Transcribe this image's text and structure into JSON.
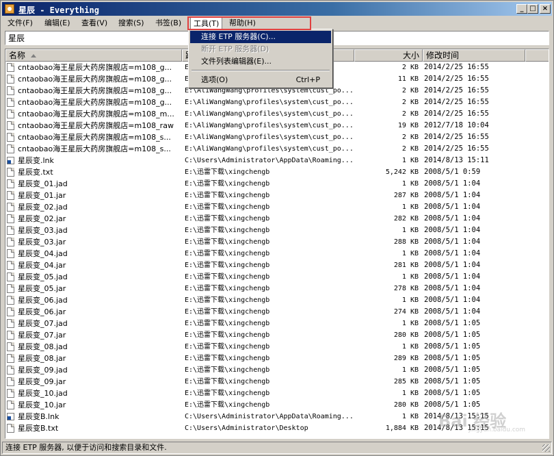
{
  "window": {
    "title": "星辰 - Everything",
    "controls": {
      "minimize": "_",
      "maximize": "□",
      "close": "×"
    }
  },
  "menubar": {
    "items": [
      {
        "label": "文件(F)"
      },
      {
        "label": "编辑(E)"
      },
      {
        "label": "查看(V)"
      },
      {
        "label": "搜索(S)"
      },
      {
        "label": "书签(B)"
      },
      {
        "label": "工具(T)"
      },
      {
        "label": "帮助(H)"
      }
    ]
  },
  "tools_menu": {
    "items": [
      {
        "label": "连接 ETP 服务器(C)...",
        "shortcut": "",
        "state": "active"
      },
      {
        "label": "断开 ETP 服务器(D)",
        "shortcut": "",
        "state": "disabled"
      },
      {
        "label": "文件列表编辑器(E)...",
        "shortcut": "",
        "state": "normal"
      },
      {
        "label": "选项(O)",
        "shortcut": "Ctrl+P",
        "state": "normal"
      }
    ]
  },
  "search": {
    "value": "星辰",
    "placeholder": ""
  },
  "columns": {
    "name": "名称",
    "path": "路",
    "size": "大小",
    "date": "修改时间"
  },
  "rows": [
    {
      "icon": "file",
      "name": "cntaobao海王星辰大药房旗舰店=m108_g...",
      "path": "E:",
      "size": "2 KB",
      "date": "2014/2/25 16:55"
    },
    {
      "icon": "file",
      "name": "cntaobao海王星辰大药房旗舰店=m108_g...",
      "path": "E:",
      "size": "11 KB",
      "date": "2014/2/25 16:55"
    },
    {
      "icon": "file",
      "name": "cntaobao海王星辰大药房旗舰店=m108_g...",
      "path": "E:\\AliWangWang\\profiles\\system\\cust_po...",
      "size": "2 KB",
      "date": "2014/2/25 16:55"
    },
    {
      "icon": "file",
      "name": "cntaobao海王星辰大药房旗舰店=m108_g...",
      "path": "E:\\AliWangWang\\profiles\\system\\cust_po...",
      "size": "2 KB",
      "date": "2014/2/25 16:55"
    },
    {
      "icon": "file",
      "name": "cntaobao海王星辰大药房旗舰店=m108_m...",
      "path": "E:\\AliWangWang\\profiles\\system\\cust_po...",
      "size": "2 KB",
      "date": "2014/2/25 16:55"
    },
    {
      "icon": "file",
      "name": "cntaobao海王星辰大药房旗舰店=m108_raw",
      "path": "E:\\AliWangWang\\profiles\\system\\cust_po...",
      "size": "19 KB",
      "date": "2012/7/18 10:04"
    },
    {
      "icon": "file",
      "name": "cntaobao海王星辰大药房旗舰店=m108_s...",
      "path": "E:\\AliWangWang\\profiles\\system\\cust_po...",
      "size": "2 KB",
      "date": "2014/2/25 16:55"
    },
    {
      "icon": "file",
      "name": "cntaobao海王星辰大药房旗舰店=m108_s...",
      "path": "E:\\AliWangWang\\profiles\\system\\cust_po...",
      "size": "2 KB",
      "date": "2014/2/25 16:55"
    },
    {
      "icon": "lnk",
      "name": "星辰变.lnk",
      "path": "C:\\Users\\Administrator\\AppData\\Roaming...",
      "size": "1 KB",
      "date": "2014/8/13 15:11"
    },
    {
      "icon": "file",
      "name": "星辰变.txt",
      "path": "E:\\迅雷下载\\xingchengb",
      "size": "5,242 KB",
      "date": "2008/5/1 0:59"
    },
    {
      "icon": "file",
      "name": "星辰变_01.jad",
      "path": "E:\\迅雷下载\\xingchengb",
      "size": "1 KB",
      "date": "2008/5/1 1:04"
    },
    {
      "icon": "file",
      "name": "星辰变_01.jar",
      "path": "E:\\迅雷下载\\xingchengb",
      "size": "287 KB",
      "date": "2008/5/1 1:04"
    },
    {
      "icon": "file",
      "name": "星辰变_02.jad",
      "path": "E:\\迅雷下载\\xingchengb",
      "size": "1 KB",
      "date": "2008/5/1 1:04"
    },
    {
      "icon": "file",
      "name": "星辰变_02.jar",
      "path": "E:\\迅雷下载\\xingchengb",
      "size": "282 KB",
      "date": "2008/5/1 1:04"
    },
    {
      "icon": "file",
      "name": "星辰变_03.jad",
      "path": "E:\\迅雷下载\\xingchengb",
      "size": "1 KB",
      "date": "2008/5/1 1:04"
    },
    {
      "icon": "file",
      "name": "星辰变_03.jar",
      "path": "E:\\迅雷下载\\xingchengb",
      "size": "288 KB",
      "date": "2008/5/1 1:04"
    },
    {
      "icon": "file",
      "name": "星辰变_04.jad",
      "path": "E:\\迅雷下载\\xingchengb",
      "size": "1 KB",
      "date": "2008/5/1 1:04"
    },
    {
      "icon": "file",
      "name": "星辰变_04.jar",
      "path": "E:\\迅雷下载\\xingchengb",
      "size": "281 KB",
      "date": "2008/5/1 1:04"
    },
    {
      "icon": "file",
      "name": "星辰变_05.jad",
      "path": "E:\\迅雷下载\\xingchengb",
      "size": "1 KB",
      "date": "2008/5/1 1:04"
    },
    {
      "icon": "file",
      "name": "星辰变_05.jar",
      "path": "E:\\迅雷下载\\xingchengb",
      "size": "278 KB",
      "date": "2008/5/1 1:04"
    },
    {
      "icon": "file",
      "name": "星辰变_06.jad",
      "path": "E:\\迅雷下载\\xingchengb",
      "size": "1 KB",
      "date": "2008/5/1 1:04"
    },
    {
      "icon": "file",
      "name": "星辰变_06.jar",
      "path": "E:\\迅雷下载\\xingchengb",
      "size": "274 KB",
      "date": "2008/5/1 1:04"
    },
    {
      "icon": "file",
      "name": "星辰变_07.jad",
      "path": "E:\\迅雷下载\\xingchengb",
      "size": "1 KB",
      "date": "2008/5/1 1:05"
    },
    {
      "icon": "file",
      "name": "星辰变_07.jar",
      "path": "E:\\迅雷下载\\xingchengb",
      "size": "280 KB",
      "date": "2008/5/1 1:05"
    },
    {
      "icon": "file",
      "name": "星辰变_08.jad",
      "path": "E:\\迅雷下载\\xingchengb",
      "size": "1 KB",
      "date": "2008/5/1 1:05"
    },
    {
      "icon": "file",
      "name": "星辰变_08.jar",
      "path": "E:\\迅雷下载\\xingchengb",
      "size": "289 KB",
      "date": "2008/5/1 1:05"
    },
    {
      "icon": "file",
      "name": "星辰变_09.jad",
      "path": "E:\\迅雷下载\\xingchengb",
      "size": "1 KB",
      "date": "2008/5/1 1:05"
    },
    {
      "icon": "file",
      "name": "星辰变_09.jar",
      "path": "E:\\迅雷下载\\xingchengb",
      "size": "285 KB",
      "date": "2008/5/1 1:05"
    },
    {
      "icon": "file",
      "name": "星辰变_10.jad",
      "path": "E:\\迅雷下载\\xingchengb",
      "size": "1 KB",
      "date": "2008/5/1 1:05"
    },
    {
      "icon": "file",
      "name": "星辰变_10.jar",
      "path": "E:\\迅雷下载\\xingchengb",
      "size": "280 KB",
      "date": "2008/5/1 1:05"
    },
    {
      "icon": "lnk",
      "name": "星辰变B.lnk",
      "path": "C:\\Users\\Administrator\\AppData\\Roaming...",
      "size": "1 KB",
      "date": "2014/8/13 15:15"
    },
    {
      "icon": "file",
      "name": "星辰变B.txt",
      "path": "C:\\Users\\Administrator\\Desktop",
      "size": "1,884 KB",
      "date": "2014/8/13 15:15"
    }
  ],
  "status": {
    "text": "连接 ETP 服务器, 以便于访问和搜索目录和文件."
  },
  "watermark": {
    "text": "Bai 经验",
    "sub": "jingyan.baidu.com"
  }
}
